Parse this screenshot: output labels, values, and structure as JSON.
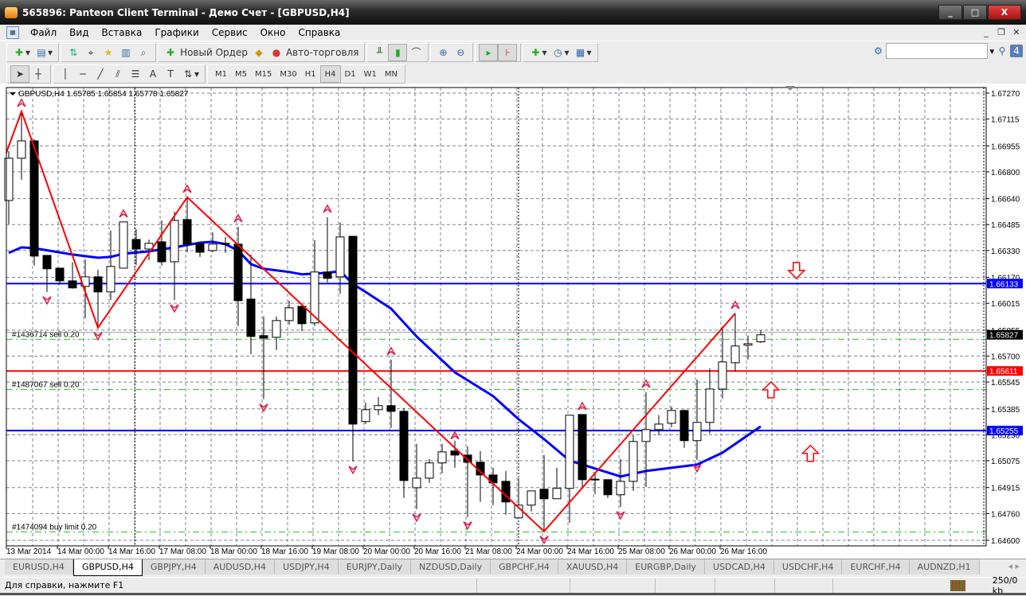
{
  "window": {
    "title": "565896: Panteon Client Terminal - Демо Счет - [GBPUSD,H4]",
    "min": "_",
    "max": "□",
    "close": "X"
  },
  "menu": [
    "Файл",
    "Вид",
    "Вставка",
    "Графики",
    "Сервис",
    "Окно",
    "Справка"
  ],
  "mdi": [
    "_",
    "❐",
    "✕"
  ],
  "toolbar": {
    "new_order": "Новый Ордер",
    "auto_trading": "Авто-торговля",
    "timeframes": [
      "M1",
      "M5",
      "M15",
      "M30",
      "H1",
      "H4",
      "D1",
      "W1",
      "MN"
    ],
    "active_timeframe": "H4",
    "search_placeholder": "",
    "badge": "4"
  },
  "chart_data": {
    "type": "candlestick",
    "symbol_header": "GBPUSD,H4  1.65785 1.65854 1.65778 1.65827",
    "ylim": [
      1.646,
      1.6727
    ],
    "y_ticks": [
      "1.67270",
      "1.67115",
      "1.66955",
      "1.66800",
      "1.66640",
      "1.66485",
      "1.66330",
      "1.66170",
      "1.66015",
      "1.65855",
      "1.65700",
      "1.65545",
      "1.65385",
      "1.65230",
      "1.65075",
      "1.64915",
      "1.64760",
      "1.64600"
    ],
    "x_ticks": [
      {
        "index": 0,
        "label": "13 Mar 2014"
      },
      {
        "index": 4,
        "label": "14 Mar 00:00"
      },
      {
        "index": 8,
        "label": "14 Mar 16:00"
      },
      {
        "index": 12,
        "label": "17 Mar 08:00"
      },
      {
        "index": 16,
        "label": "18 Mar 00:00"
      },
      {
        "index": 20,
        "label": "18 Mar 16:00"
      },
      {
        "index": 24,
        "label": "19 Mar 08:00"
      },
      {
        "index": 28,
        "label": "20 Mar 00:00"
      },
      {
        "index": 32,
        "label": "20 Mar 16:00"
      },
      {
        "index": 36,
        "label": "21 Mar 08:00"
      },
      {
        "index": 40,
        "label": "24 Mar 00:00"
      },
      {
        "index": 44,
        "label": "24 Mar 16:00"
      },
      {
        "index": 48,
        "label": "25 Mar 08:00"
      },
      {
        "index": 52,
        "label": "26 Mar 00:00"
      },
      {
        "index": 56,
        "label": "26 Mar 16:00"
      }
    ],
    "day_separators": [
      9.9,
      40,
      76.5
    ],
    "ohlc": [
      [
        1.66629,
        1.66924,
        1.66487,
        1.66881
      ],
      [
        1.66881,
        1.67161,
        1.66753,
        1.66985
      ],
      [
        1.66985,
        1.66995,
        1.6624,
        1.66297
      ],
      [
        1.66301,
        1.66301,
        1.66083,
        1.66221
      ],
      [
        1.66225,
        1.66225,
        1.66126,
        1.66149
      ],
      [
        1.66149,
        1.66259,
        1.66102,
        1.66107
      ],
      [
        1.66116,
        1.66278,
        1.65926,
        1.66173
      ],
      [
        1.66173,
        1.66216,
        1.65869,
        1.66083
      ],
      [
        1.66083,
        1.66449,
        1.66035,
        1.66235
      ],
      [
        1.66225,
        1.66501,
        1.66225,
        1.66501
      ],
      [
        1.66396,
        1.66458,
        1.66244,
        1.66339
      ],
      [
        1.66339,
        1.66396,
        1.66273,
        1.66373
      ],
      [
        1.66382,
        1.6651,
        1.6624,
        1.66263
      ],
      [
        1.66263,
        1.66563,
        1.66035,
        1.6651
      ],
      [
        1.66515,
        1.66648,
        1.6632,
        1.66368
      ],
      [
        1.66373,
        1.66373,
        1.66292,
        1.6632
      ],
      [
        1.6633,
        1.66439,
        1.6632,
        1.66368
      ],
      [
        1.66373,
        1.66411,
        1.66316,
        1.66368
      ],
      [
        1.66368,
        1.66472,
        1.65879,
        1.66031
      ],
      [
        1.6604,
        1.66306,
        1.65712,
        1.65817
      ],
      [
        1.65822,
        1.65936,
        1.65442,
        1.65807
      ],
      [
        1.65812,
        1.65936,
        1.65736,
        1.65912
      ],
      [
        1.65912,
        1.66031,
        1.65888,
        1.65988
      ],
      [
        1.65997,
        1.65997,
        1.6585,
        1.65893
      ],
      [
        1.65898,
        1.66392,
        1.65879,
        1.66202
      ],
      [
        1.66202,
        1.66529,
        1.6614,
        1.66164
      ],
      [
        1.66173,
        1.66496,
        1.66073,
        1.66411
      ],
      [
        1.66415,
        1.66415,
        1.65071,
        1.65294
      ],
      [
        1.65309,
        1.65423,
        1.65294,
        1.6538
      ],
      [
        1.6538,
        1.65456,
        1.65347,
        1.65404
      ],
      [
        1.65404,
        1.65679,
        1.65271,
        1.6537
      ],
      [
        1.6537,
        1.65389,
        1.64853,
        1.64957
      ],
      [
        1.64914,
        1.65176,
        1.64786,
        1.64971
      ],
      [
        1.64971,
        1.65085,
        1.64943,
        1.65062
      ],
      [
        1.65062,
        1.65176,
        1.65,
        1.65128
      ],
      [
        1.65133,
        1.65195,
        1.65033,
        1.65109
      ],
      [
        1.65109,
        1.65161,
        1.64739,
        1.65066
      ],
      [
        1.65066,
        1.65133,
        1.64829,
        1.6499
      ],
      [
        1.6499,
        1.65033,
        1.6481,
        1.64943
      ],
      [
        1.64952,
        1.65014,
        1.64753,
        1.64829
      ],
      [
        1.64734,
        1.64971,
        1.64734,
        1.6481
      ],
      [
        1.6481,
        1.64895,
        1.64772,
        1.64895
      ],
      [
        1.64905,
        1.65109,
        1.64653,
        1.64848
      ],
      [
        1.64848,
        1.65033,
        1.64848,
        1.6491
      ],
      [
        1.6491,
        1.65347,
        1.64705,
        1.65347
      ],
      [
        1.65351,
        1.65351,
        1.64914,
        1.64962
      ],
      [
        1.64962,
        1.65009,
        1.64876,
        1.64965
      ],
      [
        1.64962,
        1.64962,
        1.64853,
        1.64872
      ],
      [
        1.64872,
        1.65085,
        1.648,
        1.64952
      ],
      [
        1.64952,
        1.65228,
        1.64895,
        1.6519
      ],
      [
        1.6519,
        1.65484,
        1.64919,
        1.65261
      ],
      [
        1.65261,
        1.65347,
        1.65228,
        1.65294
      ],
      [
        1.65299,
        1.65399,
        1.65275,
        1.65375
      ],
      [
        1.65375,
        1.6538,
        1.65152,
        1.65195
      ],
      [
        1.65195,
        1.6556,
        1.65081,
        1.65304
      ],
      [
        1.65304,
        1.65627,
        1.65237,
        1.65503
      ],
      [
        1.65503,
        1.65879,
        1.65446,
        1.65665
      ],
      [
        1.6566,
        1.65955,
        1.65608,
        1.6576
      ],
      [
        1.65765,
        1.65822,
        1.65679,
        1.65774
      ],
      [
        1.65785,
        1.65854,
        1.65778,
        1.65827
      ]
    ],
    "moving_average": [
      [
        0,
        1.66316
      ],
      [
        1,
        1.66349
      ],
      [
        2,
        1.66344
      ],
      [
        5,
        1.66306
      ],
      [
        7,
        1.66287
      ],
      [
        8,
        1.66292
      ],
      [
        9,
        1.66311
      ],
      [
        11,
        1.66325
      ],
      [
        13,
        1.66349
      ],
      [
        15,
        1.66377
      ],
      [
        16,
        1.66382
      ],
      [
        17,
        1.66368
      ],
      [
        18,
        1.6633
      ],
      [
        19,
        1.66249
      ],
      [
        20,
        1.66221
      ],
      [
        22,
        1.66202
      ],
      [
        23,
        1.66188
      ],
      [
        25,
        1.66197
      ],
      [
        26,
        1.66207
      ],
      [
        27,
        1.6613
      ],
      [
        28,
        1.66083
      ],
      [
        30,
        1.65983
      ],
      [
        32,
        1.65817
      ],
      [
        35,
        1.65603
      ],
      [
        38,
        1.65461
      ],
      [
        40,
        1.65323
      ],
      [
        42,
        1.65204
      ],
      [
        44,
        1.65076
      ],
      [
        48,
        1.64981
      ],
      [
        50,
        1.65014
      ],
      [
        54,
        1.65052
      ],
      [
        56,
        1.65123
      ],
      [
        59,
        1.6528
      ]
    ],
    "zigzag": [
      [
        -0.2,
        1.66912
      ],
      [
        1,
        1.67161
      ],
      [
        7,
        1.65869
      ],
      [
        14,
        1.66648
      ],
      [
        42,
        1.64653
      ],
      [
        57,
        1.65955
      ]
    ],
    "fractals_up": [
      [
        1,
        1.67161
      ],
      [
        9,
        1.66501
      ],
      [
        14,
        1.66648
      ],
      [
        18,
        1.66472
      ],
      [
        25,
        1.66529
      ],
      [
        30,
        1.65679
      ],
      [
        35,
        1.65176
      ],
      [
        45,
        1.65351
      ],
      [
        50,
        1.65484
      ],
      [
        57,
        1.65955
      ]
    ],
    "fractals_down": [
      [
        3,
        1.66083
      ],
      [
        7,
        1.65869
      ],
      [
        13,
        1.66035
      ],
      [
        20,
        1.65442
      ],
      [
        27,
        1.65071
      ],
      [
        32,
        1.64786
      ],
      [
        36,
        1.64739
      ],
      [
        42,
        1.64653
      ],
      [
        48,
        1.648
      ],
      [
        54,
        1.65081
      ]
    ],
    "hlines": [
      {
        "price": 1.66133,
        "label": "1.66133",
        "color": "#0000ff"
      },
      {
        "price": 1.65611,
        "label": "1.65611",
        "color": "#ff0000"
      },
      {
        "price": 1.65255,
        "label": "1.65255",
        "color": "#0000ff"
      }
    ],
    "bid": {
      "price": 1.65827,
      "label": "1.65827"
    },
    "orders": [
      {
        "price": 1.658,
        "label": "#1436714 sell 0.20"
      },
      {
        "price": 1.655,
        "label": "#1487067 sell 0.20"
      },
      {
        "price": 1.6465,
        "label": "#1474094 buy limit 0.20"
      }
    ],
    "signal_arrows": [
      {
        "dir": "down",
        "index": 61.8,
        "price": 1.66211
      },
      {
        "dir": "up",
        "index": 59.8,
        "price": 1.65498
      },
      {
        "dir": "up",
        "index": 62.9,
        "price": 1.65119
      }
    ],
    "colors": {
      "bull": "#ffffff",
      "bear": "#000000",
      "ma": "#0000ff",
      "zigzag": "#ff0000",
      "fractal": "#e0204a",
      "grid": "#7a8594",
      "order": "#22cc22"
    }
  },
  "tabs": [
    "EURUSD,H4",
    "GBPUSD,H4",
    "GBPJPY,H4",
    "AUDUSD,H4",
    "USDJPY,H4",
    "EURJPY,Daily",
    "NZDUSD,Daily",
    "GBPCHF,H4",
    "XAUUSD,H4",
    "EURGBP,Daily",
    "USDCAD,H4",
    "USDCHF,H4",
    "EURCHF,H4",
    "AUDNZD,H1"
  ],
  "active_tab": "GBPUSD,H4",
  "tab_nav": "◂ ▸",
  "status": {
    "help": "Для справки, нажмите F1",
    "traffic": "250/0 kb"
  }
}
